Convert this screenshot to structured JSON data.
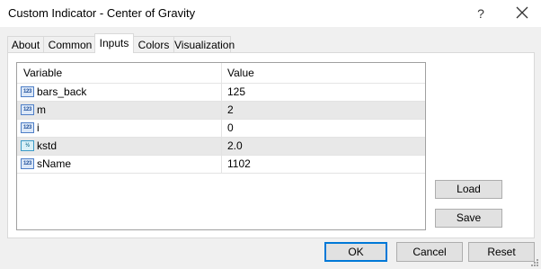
{
  "window": {
    "title": "Custom Indicator - Center of Gravity",
    "help_label": "?"
  },
  "tabs": [
    {
      "label": "About"
    },
    {
      "label": "Common"
    },
    {
      "label": "Inputs"
    },
    {
      "label": "Colors"
    },
    {
      "label": "Visualization"
    }
  ],
  "active_tab": "Inputs",
  "grid": {
    "headers": {
      "variable": "Variable",
      "value": "Value"
    },
    "rows": [
      {
        "icon": "123",
        "type": "int",
        "name": "bars_back",
        "value": "125"
      },
      {
        "icon": "123",
        "type": "int",
        "name": "m",
        "value": "2"
      },
      {
        "icon": "123",
        "type": "int",
        "name": "i",
        "value": "0"
      },
      {
        "icon": "½",
        "type": "double",
        "name": "kstd",
        "value": "2.0"
      },
      {
        "icon": "123",
        "type": "int",
        "name": "sName",
        "value": "1102"
      }
    ]
  },
  "side_buttons": {
    "load": "Load",
    "save": "Save"
  },
  "footer_buttons": {
    "ok": "OK",
    "cancel": "Cancel",
    "reset": "Reset"
  },
  "colors": {
    "accent": "#0078d7",
    "grid_border": "#a0a0a0",
    "alt_row": "#e8e8e8"
  }
}
